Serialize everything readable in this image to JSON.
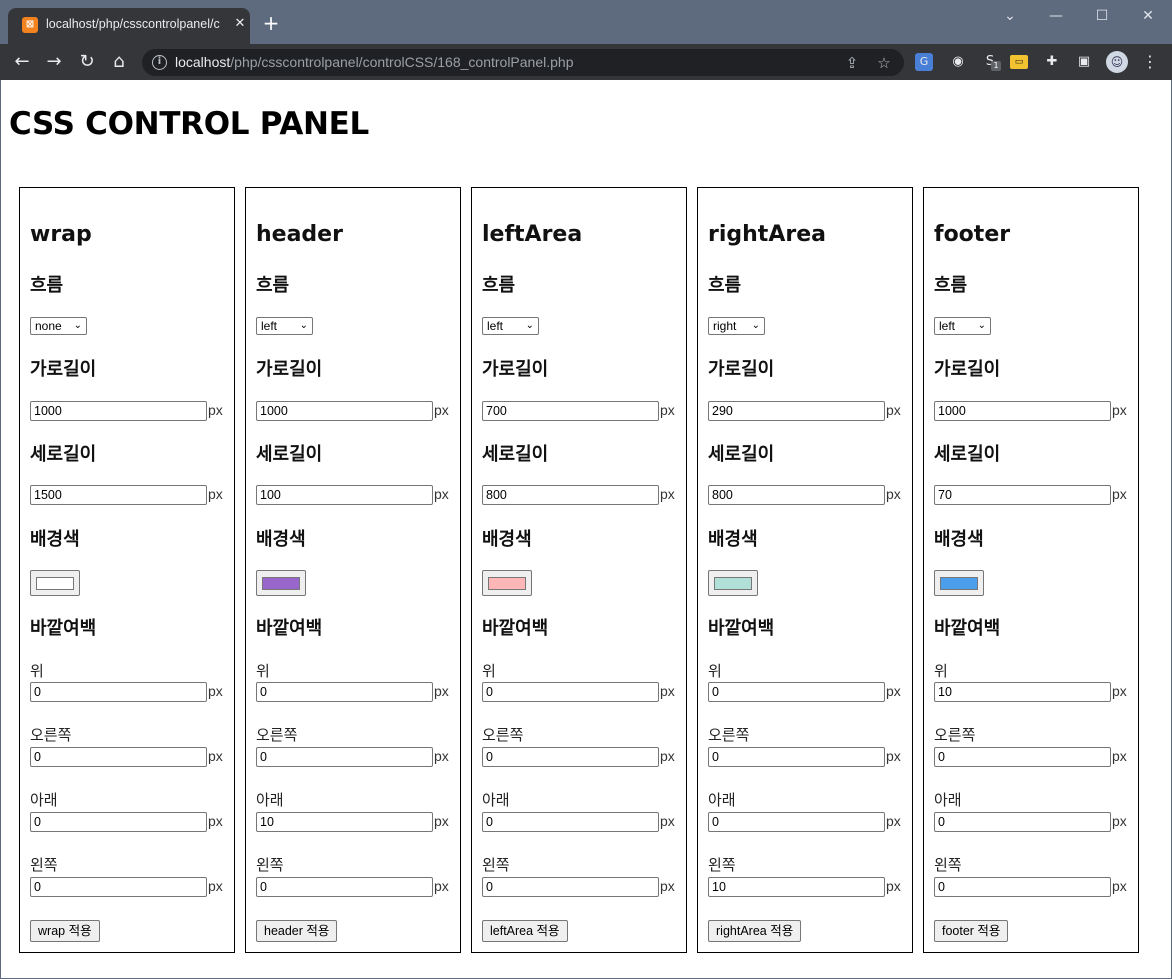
{
  "browser": {
    "tab_title": "localhost/php/csscontrolpanel/c",
    "tab_favicon": "xampp-icon",
    "url_host": "localhost",
    "url_path": "/php/csscontrolpanel/controlCSS/168_controlPanel.php",
    "extension_badge": "1"
  },
  "page": {
    "title": "CSS CONTROL PANEL"
  },
  "labels": {
    "float": "흐름",
    "width": "가로길이",
    "height": "세로길이",
    "bg": "배경색",
    "margin": "바깥여백",
    "top": "위",
    "right": "오른쪽",
    "bottom": "아래",
    "left": "왼쪽",
    "unit": "px"
  },
  "panels": [
    {
      "name": "wrap",
      "float": "none",
      "width": "1000",
      "height": "1500",
      "bg_color": "#ffffff",
      "margin_top": "0",
      "margin_right": "0",
      "margin_bottom": "0",
      "margin_left": "0",
      "button": "wrap 적용"
    },
    {
      "name": "header",
      "float": "left",
      "width": "1000",
      "height": "100",
      "bg_color": "#9966cc",
      "margin_top": "0",
      "margin_right": "0",
      "margin_bottom": "10",
      "margin_left": "0",
      "button": "header 적용"
    },
    {
      "name": "leftArea",
      "float": "left",
      "width": "700",
      "height": "800",
      "bg_color": "#ffb6b6",
      "margin_top": "0",
      "margin_right": "0",
      "margin_bottom": "0",
      "margin_left": "0",
      "button": "leftArea 적용"
    },
    {
      "name": "rightArea",
      "float": "right",
      "width": "290",
      "height": "800",
      "bg_color": "#b0e0d8",
      "margin_top": "0",
      "margin_right": "0",
      "margin_bottom": "0",
      "margin_left": "10",
      "button": "rightArea 적용"
    },
    {
      "name": "footer",
      "float": "left",
      "width": "1000",
      "height": "70",
      "bg_color": "#4a9eea",
      "margin_top": "10",
      "margin_right": "0",
      "margin_bottom": "0",
      "margin_left": "0",
      "button": "footer 적용"
    }
  ]
}
